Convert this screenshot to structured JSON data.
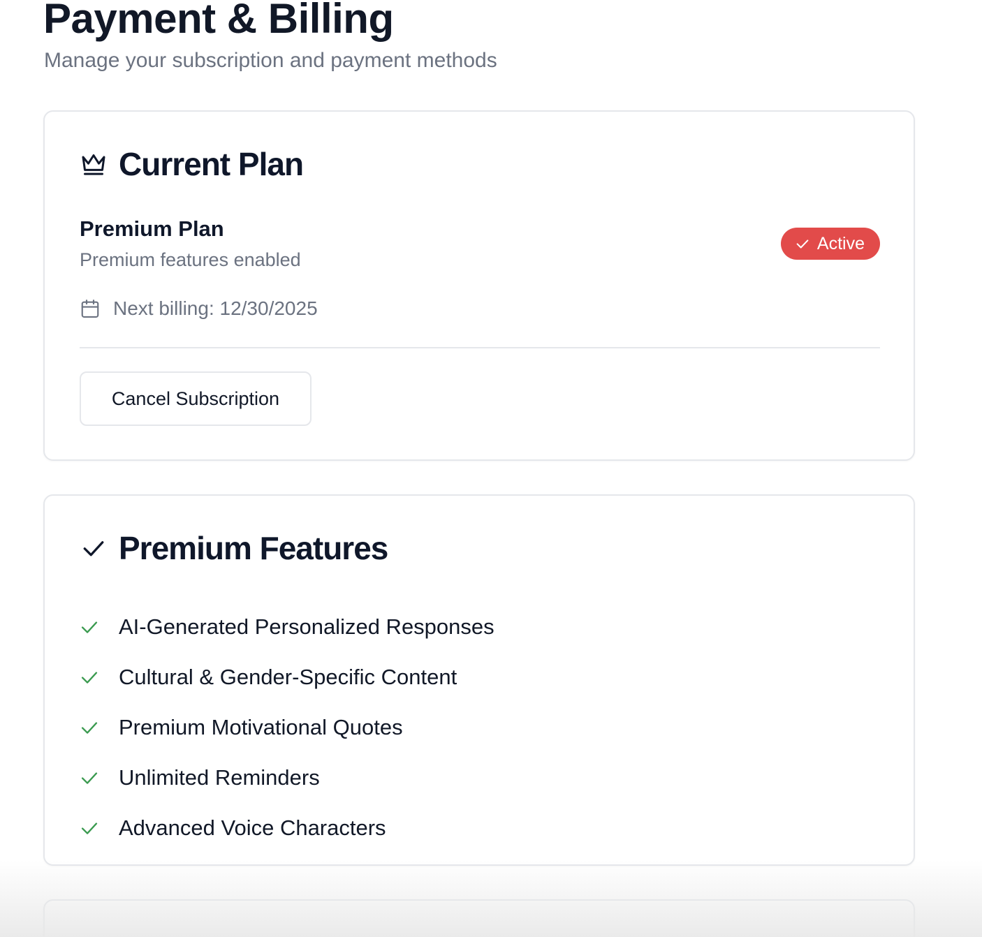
{
  "header": {
    "title": "Payment & Billing",
    "subtitle": "Manage your subscription and payment methods"
  },
  "current_plan": {
    "title": "Current Plan",
    "icon": "crown-icon",
    "plan_name": "Premium Plan",
    "plan_description": "Premium features enabled",
    "status_badge": {
      "label": "Active",
      "icon": "check-icon",
      "color": "#e24b4a"
    },
    "billing_icon": "calendar-icon",
    "next_billing": "Next billing: 12/30/2025",
    "cancel_button_label": "Cancel Subscription"
  },
  "premium_features": {
    "title": "Premium Features",
    "icon": "check-icon",
    "check_color": "#3a9a4f",
    "items": [
      "AI-Generated Personalized Responses",
      "Cultural & Gender-Specific Content",
      "Premium Motivational Quotes",
      "Unlimited Reminders",
      "Advanced Voice Characters"
    ]
  }
}
